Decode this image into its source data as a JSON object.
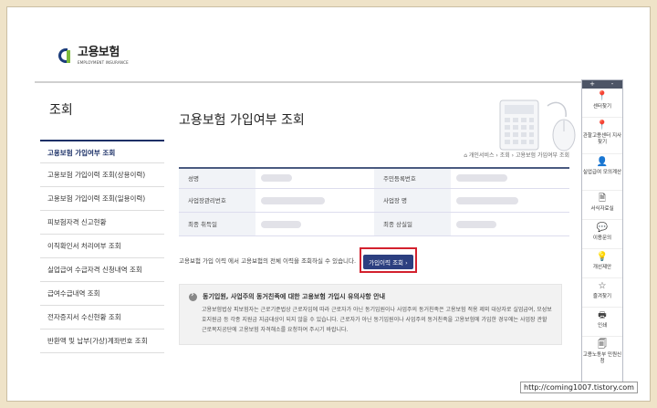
{
  "logo": {
    "name": "고용보험",
    "subtitle": "EMPLOYMENT INSURANCE"
  },
  "sidebar": {
    "title": "조회",
    "items": [
      {
        "label": "고용보험 가입여부 조회",
        "active": true
      },
      {
        "label": "고용보험 가입이력 조회(상용이력)"
      },
      {
        "label": "고용보험 가입이력 조회(일용이력)"
      },
      {
        "label": "피보험자격 신고현황"
      },
      {
        "label": "이직확인서 처리여부 조회"
      },
      {
        "label": "실업급여 수급자격 신청내역 조회"
      },
      {
        "label": "급여수급내역 조회"
      },
      {
        "label": "전자증지서 수신현황 조회"
      },
      {
        "label": "반환액 및 납부(가상)계좌번호 조회"
      }
    ]
  },
  "main": {
    "title": "고용보험 가입여부 조회",
    "breadcrumb": "개인서비스 › 조회 › 고용보험 가입여부 조회",
    "labels": {
      "name": "성명",
      "reg_no": "주민등록번호",
      "biz_no": "사업장관리번호",
      "biz_name": "사업장 명",
      "acquire_date": "최종 취득일",
      "loss_date": "최종 상실일"
    },
    "notice": "고용보험 가입 이력 에서 고용보험의 전체 이력을 조회하실 수 있습니다.",
    "history_button": "가입이력 조회 ›",
    "guide_title": "동기입원, 사업주의 동거친족에 대한 고용보험 가입시 유의사항 안내",
    "guide_body": "고용보험법상 피보험자는 근로기준법상 근로자임에 따라 근로자가 아닌 동기입원이나 사업주의 동거친족은 고용보험 적용 제외 대상자로 실업급여, 모성보호지원금 등 각종 지원금 지급대상이 되지 않을 수 있습니다. 근로자가 아닌 동기입원이나 사업주의 동거친족을 고용보험에 가입한 경우에는 사업장 관할 근로복지공단에 고용보험 자격해소를 요청하여 주시기 바랍니다."
  },
  "quick_menu": {
    "header": [
      "+",
      "-"
    ],
    "items": [
      {
        "icon": "map-pin-icon",
        "glyph": "📍",
        "label": "센터찾기"
      },
      {
        "icon": "map-pin-icon",
        "glyph": "📍",
        "label": "관할고용센터 지사찾기"
      },
      {
        "icon": "person-icon",
        "glyph": "👤",
        "label": "실업급여 모의계산"
      },
      {
        "icon": "document-icon",
        "glyph": "🗎",
        "label": "서식자료실"
      },
      {
        "icon": "chat-icon",
        "glyph": "💬",
        "label": "이용문의"
      },
      {
        "icon": "lightbulb-icon",
        "glyph": "💡",
        "label": "개선제안"
      },
      {
        "icon": "star-icon",
        "glyph": "☆",
        "label": "즐겨찾기"
      },
      {
        "icon": "printer-icon",
        "glyph": "🖶",
        "label": "인쇄"
      },
      {
        "icon": "document-icon",
        "glyph": "🗐",
        "label": "고용노동부 민원신청"
      }
    ]
  },
  "watermark": "http://coming1007.tistory.com"
}
